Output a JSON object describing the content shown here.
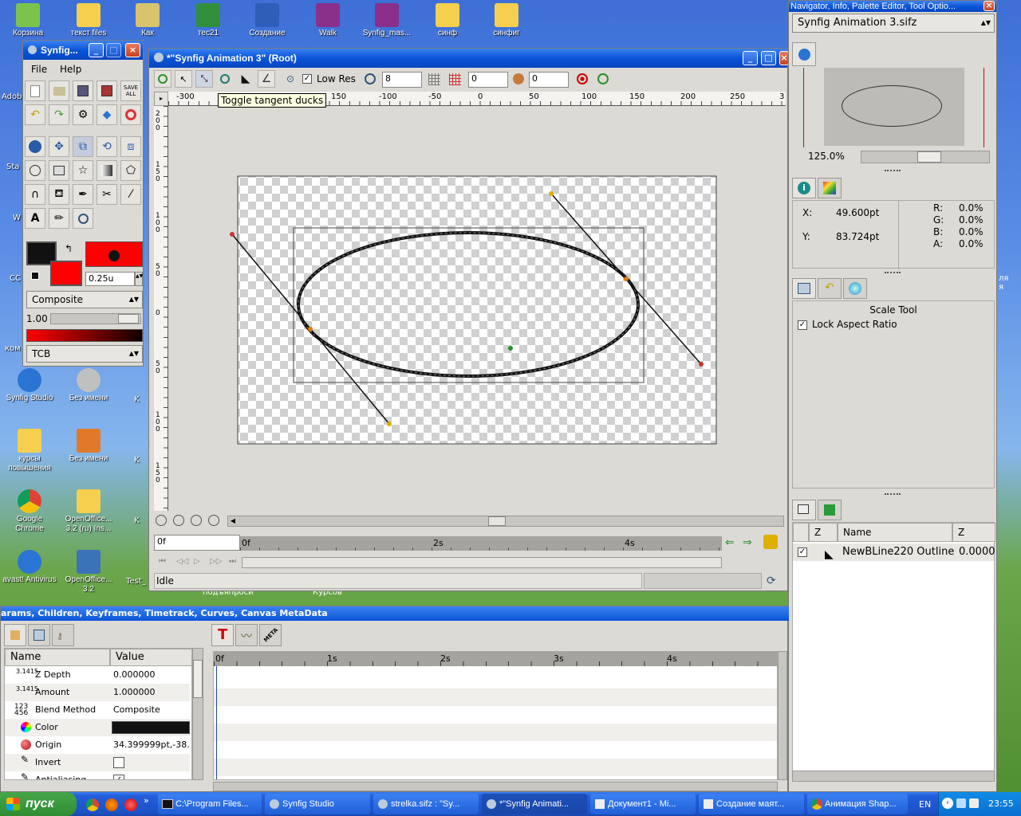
{
  "desktop": {
    "icons_top": [
      "Корзина",
      "текст files",
      "Как",
      "тес21",
      "Создание",
      "Walk",
      "Synfig_mas...",
      "синф",
      "синфиг"
    ],
    "icons_left": [
      {
        "label": "Synfig Studio"
      },
      {
        "label": "Без имени"
      },
      {
        "label": "курсы повышения"
      },
      {
        "label": "Без имени"
      },
      {
        "label": "Google Chrome"
      },
      {
        "label": "OpenOffice... 3.2 (ru) Ins..."
      },
      {
        "label": "avast! Antivirus"
      },
      {
        "label": "OpenOffice... 3.2"
      }
    ],
    "partial_labels": [
      "Adob",
      "Sta",
      "W",
      "CC",
      "ком",
      "K",
      "K",
      "K",
      "Test_"
    ],
    "behind_labels": [
      "подъяпроси",
      "Курсов"
    ],
    "right_partial": "ля я"
  },
  "toolbox": {
    "title": "Synfig...",
    "menu": [
      "File",
      "Help"
    ],
    "save_all": "SAVE ALL",
    "brush_size": "0.25u",
    "blend": "Composite",
    "opacity": "1.00",
    "interp": "TCB",
    "outline_color": "#111111",
    "fill_color": "#ff0000"
  },
  "canvas": {
    "title": "*\"Synfig Animation 3\" (Root)",
    "lowres_label": "Low Res",
    "res_value": "8",
    "field1": "0",
    "field2": "0",
    "tooltip": "Toggle tangent ducks",
    "ruler_h": [
      "-300",
      "150",
      "-100",
      "-50",
      "0",
      "50",
      "100",
      "150",
      "200",
      "250",
      "3"
    ],
    "ruler_v": [
      "2 0 0",
      "1 5 0",
      "1 0 0",
      "5 0",
      "0",
      "5 0",
      "1 0 0",
      "1 5 0"
    ],
    "time_field": "0f",
    "timebar_marks": [
      "0f",
      "2s",
      "4s"
    ],
    "status": "Idle"
  },
  "navigator": {
    "title": "Navigator, Info, Palette Editor, Tool Optio...",
    "file": "Synfig Animation 3.sifz",
    "zoom": "125.0%"
  },
  "info": {
    "x_label": "X:",
    "x_value": "49.600pt",
    "y_label": "Y:",
    "y_value": "83.724pt",
    "r_label": "R:",
    "r_value": "0.0%",
    "g_label": "G:",
    "g_value": "0.0%",
    "b_label": "B:",
    "b_value": "0.0%",
    "a_label": "A:",
    "a_value": "0.0%"
  },
  "tool_options": {
    "title": "Scale Tool",
    "lock_label": "Lock Aspect Ratio"
  },
  "layers": {
    "col_z": "Z",
    "col_name": "Name",
    "col_z2": "Z",
    "row_name": "NewBLine220 Outline",
    "row_z": "0.0000"
  },
  "params": {
    "title": "arams, Children, Keyframes, Timetrack, Curves, Canvas MetaData",
    "col_name": "Name",
    "col_value": "Value",
    "rows": [
      {
        "icon": "3.1415",
        "name": "Z Depth",
        "value": "0.000000"
      },
      {
        "icon": "3.1415",
        "name": "Amount",
        "value": "1.000000"
      },
      {
        "icon": "123 456",
        "name": "Blend Method",
        "value": "Composite"
      },
      {
        "icon": "",
        "name": "Color",
        "value": ""
      },
      {
        "icon": "",
        "name": "Origin",
        "value": "34.399999pt,-38."
      },
      {
        "icon": "",
        "name": "Invert",
        "value": ""
      },
      {
        "icon": "",
        "name": "Antialiasing",
        "value": ""
      }
    ],
    "timetrack_marks": [
      "0f",
      "1s",
      "2s",
      "3s",
      "4s"
    ],
    "meta_label": "META"
  },
  "taskbar": {
    "start": "пуск",
    "tasks": [
      "C:\\Program Files...",
      "Synfig Studio",
      "strelka.sifz : \"Sy...",
      "*\"Synfig Animati...",
      "Документ1 - Mi...",
      "Создание маят...",
      "Анимация Shap..."
    ],
    "lang": "EN",
    "clock": "23:55"
  }
}
